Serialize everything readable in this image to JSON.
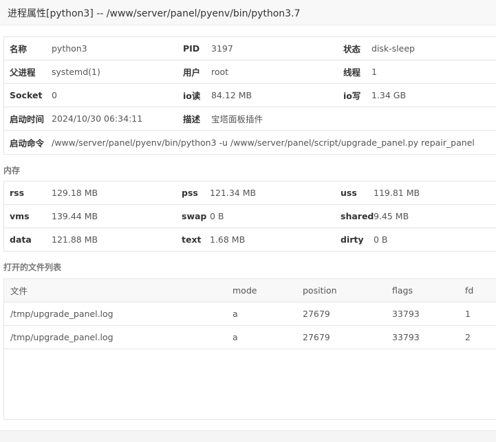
{
  "window": {
    "title": "进程属性[python3] -- /www/server/panel/pyenv/bin/python3.7"
  },
  "process": {
    "rows": [
      [
        {
          "label": "名称",
          "value": "python3"
        },
        {
          "label": "PID",
          "value": "3197"
        },
        {
          "label": "状态",
          "value": "disk-sleep"
        }
      ],
      [
        {
          "label": "父进程",
          "value": "systemd(1)"
        },
        {
          "label": "用户",
          "value": "root"
        },
        {
          "label": "线程",
          "value": "1"
        }
      ],
      [
        {
          "label": "Socket",
          "value": "0"
        },
        {
          "label": "io读",
          "value": "84.12 MB"
        },
        {
          "label": "io写",
          "value": "1.34 GB"
        }
      ],
      [
        {
          "label": "启动时间",
          "value": "2024/10/30 06:34:11"
        },
        {
          "label": "描述",
          "value": "宝塔面板插件"
        }
      ]
    ],
    "command": {
      "label": "启动命令",
      "value": "/www/server/panel/pyenv/bin/python3 -u /www/server/panel/script/upgrade_panel.py repair_panel"
    }
  },
  "memory": {
    "section_title": "内存",
    "rows": [
      [
        {
          "label": "rss",
          "value": "129.18 MB"
        },
        {
          "label": "pss",
          "value": "121.34 MB"
        },
        {
          "label": "uss",
          "value": "119.81 MB"
        }
      ],
      [
        {
          "label": "vms",
          "value": "139.44 MB"
        },
        {
          "label": "swap",
          "value": "0 B"
        },
        {
          "label": "shared",
          "value": "9.45 MB"
        }
      ],
      [
        {
          "label": "data",
          "value": "121.88 MB"
        },
        {
          "label": "text",
          "value": "1.68 MB"
        },
        {
          "label": "dirty",
          "value": "0 B"
        }
      ]
    ]
  },
  "files": {
    "section_title": "打开的文件列表",
    "columns": [
      "文件",
      "mode",
      "position",
      "flags",
      "fd"
    ],
    "rows": [
      [
        "/tmp/upgrade_panel.log",
        "a",
        "27679",
        "33793",
        "1"
      ],
      [
        "/tmp/upgrade_panel.log",
        "a",
        "27679",
        "33793",
        "2"
      ]
    ]
  }
}
